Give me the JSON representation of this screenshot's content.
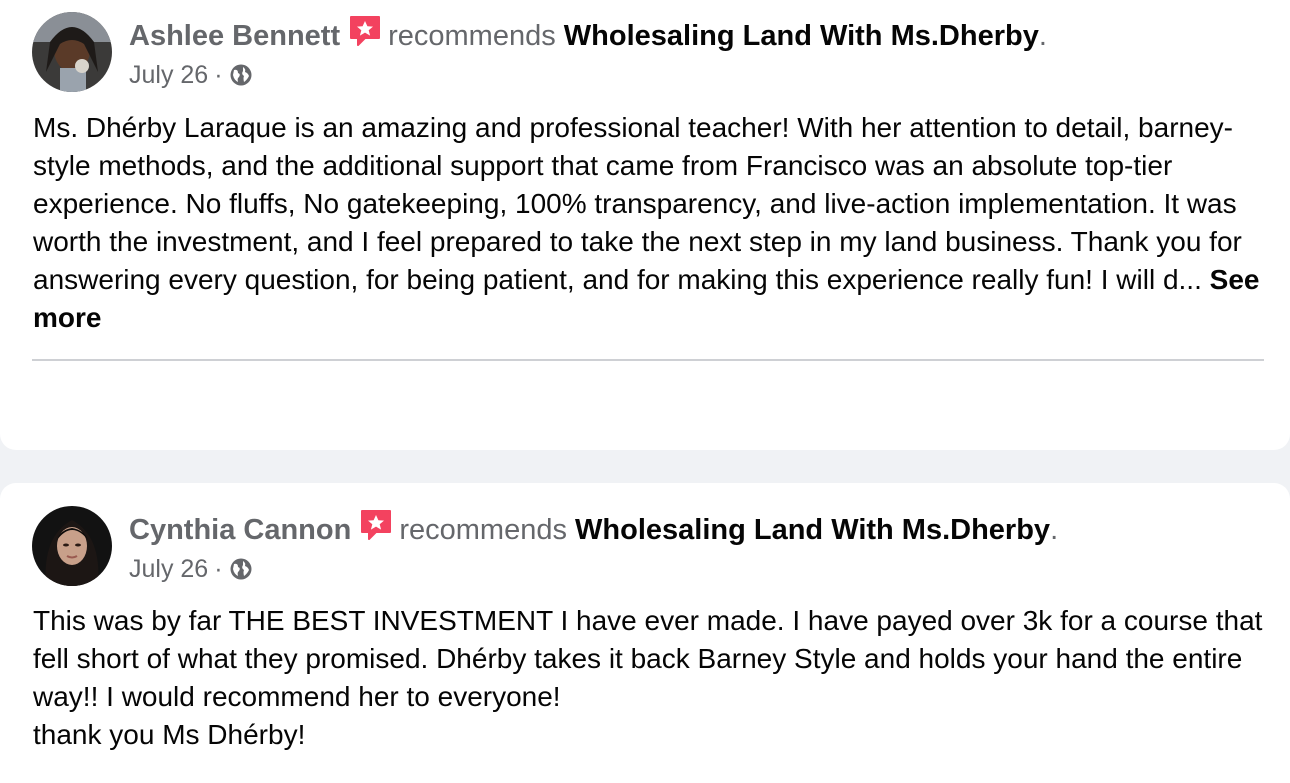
{
  "posts": [
    {
      "author": "Ashlee Bennett",
      "verb": "recommends",
      "page": "Wholesaling Land With Ms.Dherby",
      "period": ".",
      "date": "July 26",
      "separator": "·",
      "body": "Ms. Dhérby Laraque is an amazing and professional teacher! With her attention to detail, barney-style methods, and the additional support that came from Francisco was an absolute top-tier experience. No fluffs, No gatekeeping, 100% transparency, and live-action implementation. It was worth the investment, and I feel prepared to take the next step in my land business. Thank you for answering every question, for being patient, and for making this experience really fun! I will d... ",
      "see_more": "See more",
      "icons": {
        "badge": "recommendation-star-icon",
        "audience": "globe-icon"
      }
    },
    {
      "author": "Cynthia Cannon",
      "verb": "recommends",
      "page": "Wholesaling Land With Ms.Dherby",
      "period": ".",
      "date": "July 26",
      "separator": "·",
      "body_line1": "This was by far THE BEST INVESTMENT  I have ever made. I have payed over 3k for a course that fell short of what they promised. Dhérby takes it back Barney Style and holds your hand the entire way!! I would recommend her to everyone!",
      "body_line2": "thank you Ms Dhérby!",
      "icons": {
        "badge": "recommendation-star-icon",
        "audience": "globe-icon"
      }
    }
  ],
  "colors": {
    "badge": "#f3425f",
    "meta": "#65676b",
    "text": "#050505",
    "background": "#f0f2f5",
    "card": "#ffffff"
  }
}
